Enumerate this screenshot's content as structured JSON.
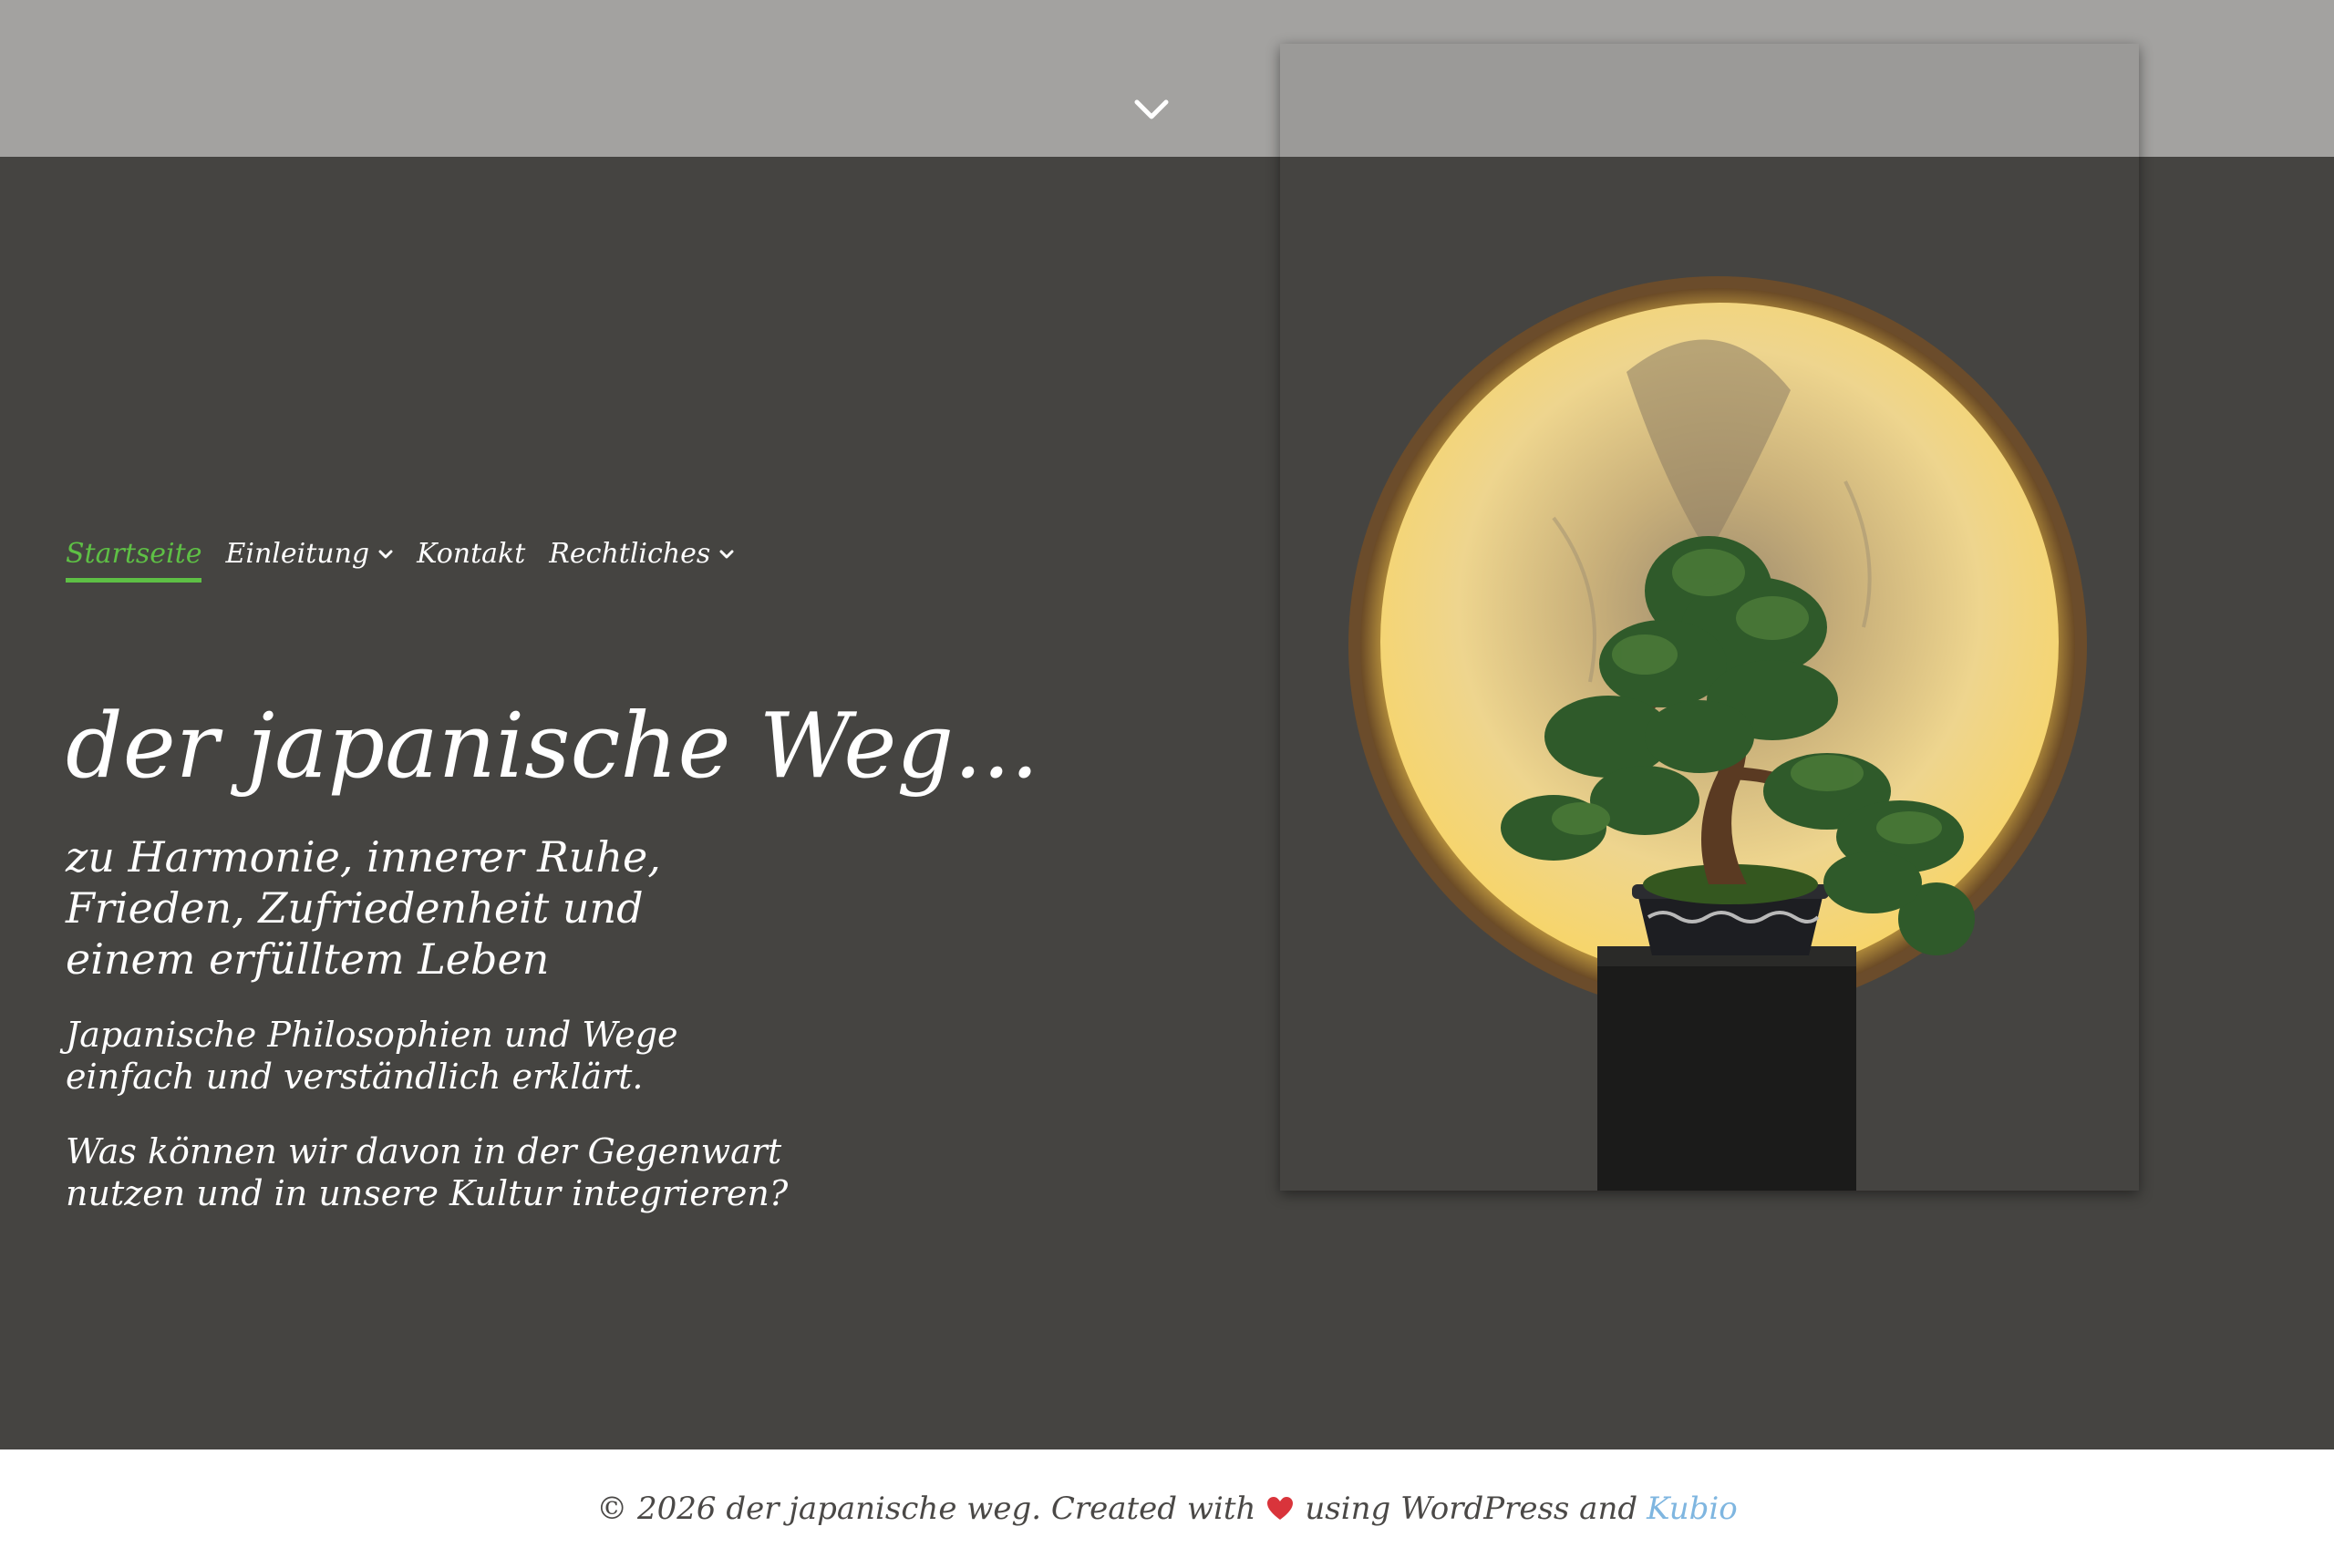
{
  "header": {
    "scroll_icon": "chevron-down-icon"
  },
  "nav": {
    "items": [
      {
        "label": "Startseite",
        "active": true,
        "has_dropdown": false
      },
      {
        "label": "Einleitung",
        "active": false,
        "has_dropdown": true
      },
      {
        "label": "Kontakt",
        "active": false,
        "has_dropdown": false
      },
      {
        "label": "Rechtliches",
        "active": false,
        "has_dropdown": true
      }
    ],
    "active_color": "#5ec045"
  },
  "hero": {
    "title": "der japanische Weg...",
    "subtitle_lines": [
      "zu Harmonie, innerer Ruhe,",
      "Frieden, Zufriedenheit und",
      "einem erfülltem Leben"
    ],
    "paragraph1_lines": [
      "Japanische Philosophien und Wege",
      "einfach und verständlich erklärt."
    ],
    "paragraph2_lines": [
      "Was können wir davon in der Gegenwart",
      "nutzen und in unsere Kultur integrieren?"
    ],
    "image": "bonsai-tree-with-golden-moon-disc"
  },
  "footer": {
    "text_before": "© 2026 der japanische weg. Created with",
    "heart_icon": "heart-icon",
    "text_after": "using WordPress and",
    "link_label": "Kubio",
    "link_color": "#7fb6e0"
  },
  "colors": {
    "topbar": "#a3a2a0",
    "background": "#454441",
    "footer_bg": "#ffffff"
  }
}
